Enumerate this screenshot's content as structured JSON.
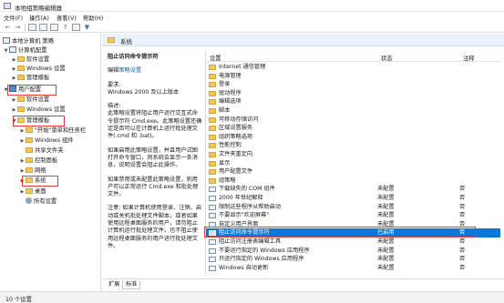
{
  "window": {
    "title": "本地组策略编辑器"
  },
  "menu": [
    "文件(F)",
    "操作(A)",
    "查看(V)",
    "帮助(H)"
  ],
  "toolbar": {
    "icons": [
      "back-icon",
      "forward-icon",
      "folder-up-icon",
      "show-hide-tree-icon",
      "export-list-icon",
      "help-icon",
      "properties-icon",
      "filter-icon"
    ]
  },
  "tree": [
    {
      "label": "本地计算机 策略",
      "icon": "computer"
    },
    {
      "label": "计算机配置",
      "icon": "computer"
    },
    {
      "label": "软件设置",
      "icon": "folder"
    },
    {
      "label": "Windows 设置",
      "icon": "folder"
    },
    {
      "label": "管理模板",
      "icon": "folder"
    },
    {
      "label": "用户配置",
      "icon": "user"
    },
    {
      "label": "软件设置",
      "icon": "folder"
    },
    {
      "label": "Windows 设置",
      "icon": "folder"
    },
    {
      "label": "管理模板",
      "icon": "folder"
    },
    {
      "label": "\"开始\"菜单和任务栏",
      "icon": "folder"
    },
    {
      "label": "Windows 组件",
      "icon": "folder"
    },
    {
      "label": "共享文件夹",
      "icon": "folder"
    },
    {
      "label": "控制面板",
      "icon": "folder"
    },
    {
      "label": "网络",
      "icon": "folder"
    },
    {
      "label": "系统",
      "icon": "folder"
    },
    {
      "label": "桌面",
      "icon": "folder"
    },
    {
      "label": "所有设置",
      "icon": "folder"
    }
  ],
  "breadcrumb": "系统",
  "description": {
    "title": "阻止访问命令提示符",
    "edit_prefix": "编辑",
    "edit_link": "策略设置",
    "req_label": "要求:",
    "req_text": "Windows 2000 及以上版本",
    "desc_label": "描述:",
    "desc_text": "此策略设置将阻止用户运行交互式命令提示符 Cmd.exe。此策略设置还确定是否可以在计算机上运行批处理文件(.cmd 和 .bat)。",
    "p2": "如果启用此策略设置，并且用户试图打开命令窗口，则系统会显示一条消息，说明设置会阻止此操作。",
    "p3": "如果禁用或未配置此策略设置，则用户可以正常运行 Cmd.exe 和批处理文件。",
    "p4": "注意: 如果计算机使用登录、注销、启动或关机批处理文件脚本，或者如果使用远程桌面服务的用户，请勿阻止计算机运行批处理文件。也不阻止使用远程桌面服务的用户运行批处理文件。"
  },
  "list": {
    "headers": {
      "name": "设置",
      "state": "状态",
      "comment": "注释"
    },
    "rows": [
      {
        "name": "Internet 通信管理",
        "type": "folder",
        "state": "",
        "comment": ""
      },
      {
        "name": "电源管理",
        "type": "folder",
        "state": "",
        "comment": ""
      },
      {
        "name": "登录",
        "type": "folder",
        "state": "",
        "comment": ""
      },
      {
        "name": "驱动程序",
        "type": "folder",
        "state": "",
        "comment": ""
      },
      {
        "name": "编辑选项",
        "type": "folder",
        "state": "",
        "comment": ""
      },
      {
        "name": "脚本",
        "type": "folder",
        "state": "",
        "comment": ""
      },
      {
        "name": "可移动存储访问",
        "type": "folder",
        "state": "",
        "comment": ""
      },
      {
        "name": "区域设置服务",
        "type": "folder",
        "state": "",
        "comment": ""
      },
      {
        "name": "组织策略选项",
        "type": "folder",
        "state": "",
        "comment": ""
      },
      {
        "name": "性能控制",
        "type": "folder",
        "state": "",
        "comment": ""
      },
      {
        "name": "文件夹重定向",
        "type": "folder",
        "state": "",
        "comment": ""
      },
      {
        "name": "显示",
        "type": "folder",
        "state": "",
        "comment": ""
      },
      {
        "name": "用户配置文件",
        "type": "folder",
        "state": "",
        "comment": ""
      },
      {
        "name": "组策略",
        "type": "folder",
        "state": "",
        "comment": ""
      },
      {
        "name": "下载缺失的 COM 组件",
        "type": "policy",
        "state": "未配置",
        "comment": "否"
      },
      {
        "name": "2000 年世纪解释",
        "type": "policy",
        "state": "未配置",
        "comment": "否"
      },
      {
        "name": "限制这些程序从帮助启动",
        "type": "policy",
        "state": "未配置",
        "comment": "否"
      },
      {
        "name": "不要显示\"欢迎屏幕\"",
        "type": "policy",
        "state": "未配置",
        "comment": "否"
      },
      {
        "name": "自定义用户界面",
        "type": "policy",
        "state": "未配置",
        "comment": "否"
      },
      {
        "name": "阻止访问命令提示符",
        "type": "policy",
        "state": "已启用",
        "comment": "否"
      },
      {
        "name": "阻止访问注册表编辑工具",
        "type": "policy",
        "state": "未配置",
        "comment": "否"
      },
      {
        "name": "不要运行指定的 Windows 应用程序",
        "type": "policy",
        "state": "未配置",
        "comment": "否"
      },
      {
        "name": "只运行指定的 Windows 应用程序",
        "type": "policy",
        "state": "未配置",
        "comment": "否"
      },
      {
        "name": "Windows 自动更新",
        "type": "policy",
        "state": "未配置",
        "comment": "否"
      }
    ]
  },
  "tabs": [
    "扩展",
    "标准"
  ],
  "status": "10 个设置",
  "colors": {
    "selection": "#0b78d7",
    "highlight_box": "#e53935",
    "link": "#1d5fb8"
  }
}
